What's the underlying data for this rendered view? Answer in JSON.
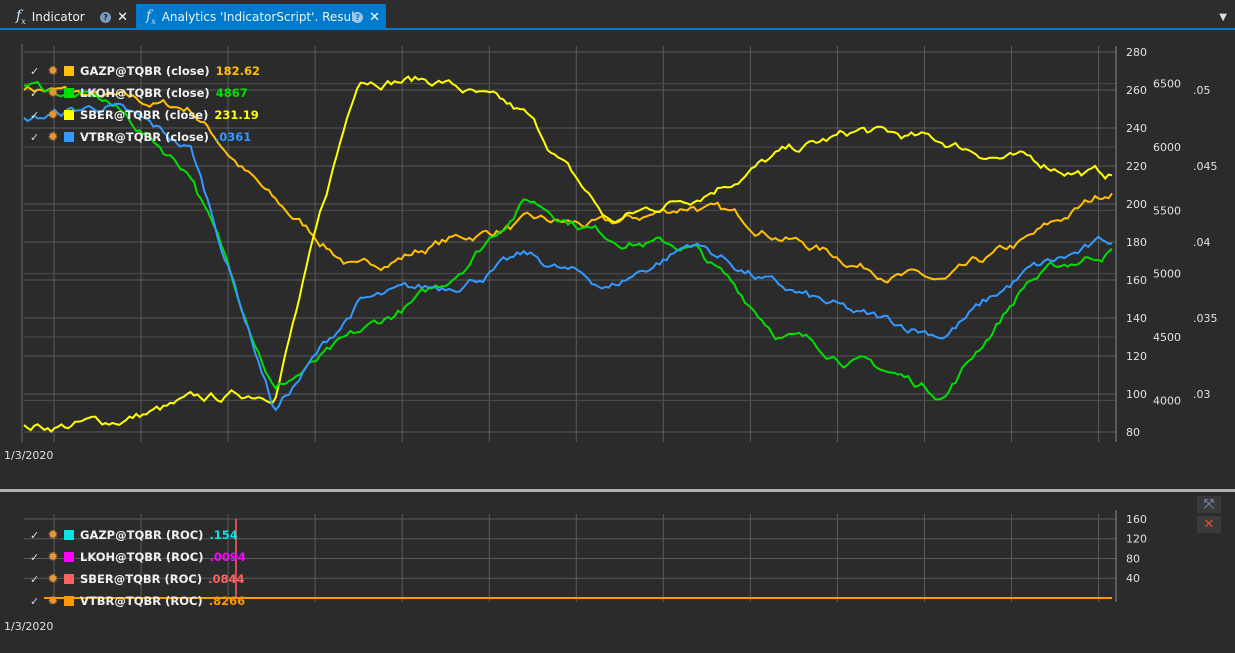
{
  "tabs": [
    {
      "label": "Indicator",
      "icon": "fx-icon",
      "active": false
    },
    {
      "label": "Analytics 'IndicatorScript'. Result",
      "icon": "fx-icon",
      "active": true
    }
  ],
  "tab_help_glyph": "?",
  "tab_close_glyph": "✕",
  "dropdown_glyph": "▼",
  "main_chart": {
    "date_label": "1/3/2020",
    "legend": [
      {
        "name": "GAZP@TQBR (close)",
        "value": "182.62",
        "color": "#ffc000"
      },
      {
        "name": "LKOH@TQBR (close)",
        "value": "4867",
        "color": "#00e000"
      },
      {
        "name": "SBER@TQBR (close)",
        "value": "231.19",
        "color": "#ffff00"
      },
      {
        "name": "VTBR@TQBR (close)",
        "value": ".0361",
        "color": "#3399ff"
      }
    ]
  },
  "roc_chart": {
    "date_label": "1/3/2020",
    "legend": [
      {
        "name": "GAZP@TQBR (ROC)",
        "value": ".154",
        "color": "#00e5e5"
      },
      {
        "name": "LKOH@TQBR (ROC)",
        "value": ".0094",
        "color": "#ff00ff"
      },
      {
        "name": "SBER@TQBR (ROC)",
        "value": ".0844",
        "color": "#ff6060"
      },
      {
        "name": "VTBR@TQBR (ROC)",
        "value": ".8266",
        "color": "#ff9900"
      }
    ]
  },
  "chart_data": [
    {
      "type": "line",
      "x": [
        "2020-01-03",
        "2020-02-01",
        "2020-03-01",
        "2020-03-15",
        "2020-04-01",
        "2020-05-01",
        "2020-06-01",
        "2020-07-01",
        "2020-08-01",
        "2020-09-01",
        "2020-10-01",
        "2020-11-01",
        "2020-12-01",
        "2021-01-01"
      ],
      "series": [
        {
          "name": "GAZP@TQBR (close)",
          "axis": "left",
          "values": [
            262,
            255,
            250,
            200,
            165,
            180,
            190,
            188,
            200,
            185,
            168,
            158,
            180,
            208
          ]
        },
        {
          "name": "SBER@TQBR (close)",
          "axis": "left",
          "values": [
            82,
            85,
            95,
            102,
            268,
            265,
            245,
            190,
            205,
            225,
            238,
            232,
            222,
            215
          ]
        },
        {
          "name": "LKOH@TQBR (close)",
          "axis": "lkoh",
          "values": [
            6500,
            6350,
            5800,
            4100,
            4500,
            4900,
            5600,
            5300,
            5200,
            4550,
            4300,
            4050,
            4950,
            5200
          ]
        },
        {
          "name": "VTBR@TQBR (close)",
          "axis": "vtbr",
          "values": [
            0.048,
            0.049,
            0.046,
            0.029,
            0.036,
            0.037,
            0.039,
            0.037,
            0.04,
            0.037,
            0.035,
            0.034,
            0.038,
            0.04
          ]
        }
      ],
      "y_axes": {
        "left": {
          "ticks": [
            280,
            260,
            240,
            220,
            200,
            180,
            160,
            140,
            120,
            100,
            80
          ],
          "range": [
            80,
            280
          ]
        },
        "lkoh": {
          "ticks": [
            6500,
            6000,
            5500,
            5000,
            4500,
            4000
          ],
          "range": [
            3750,
            6750
          ]
        },
        "vtbr": {
          "ticks": [
            ".05",
            ".045",
            ".04",
            ".035",
            ".03"
          ],
          "range": [
            0.0275,
            0.0525
          ]
        }
      },
      "grid": true
    },
    {
      "type": "line",
      "series": [
        {
          "name": "GAZP@TQBR (ROC)",
          "values": [
            0,
            0,
            0,
            0,
            0,
            0
          ]
        },
        {
          "name": "LKOH@TQBR (ROC)",
          "values": [
            0,
            0,
            0,
            0,
            0,
            0
          ]
        },
        {
          "name": "SBER@TQBR (ROC)",
          "values": [
            0,
            160,
            0,
            0,
            0,
            0
          ]
        },
        {
          "name": "VTBR@TQBR (ROC)",
          "values": [
            0,
            0,
            0,
            0,
            0,
            0
          ]
        }
      ],
      "y_axis": {
        "ticks": [
          160,
          120,
          80,
          40
        ],
        "range": [
          0,
          170
        ]
      },
      "grid": true
    }
  ]
}
